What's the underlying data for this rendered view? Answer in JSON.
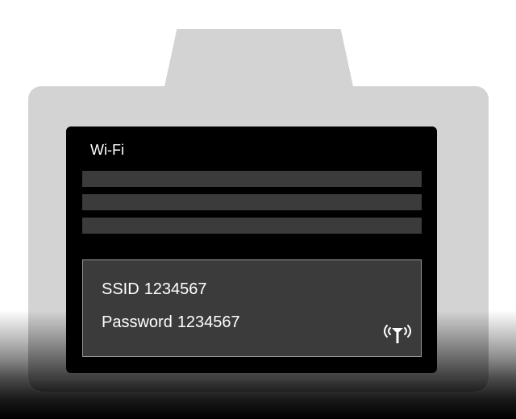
{
  "screen": {
    "title": "Wi-Fi"
  },
  "connection_info": {
    "ssid_label": "SSID",
    "ssid_value": "1234567",
    "password_label": "Password",
    "password_value": "1234567"
  },
  "icons": {
    "status": "wifi-antenna-icon"
  },
  "colors": {
    "camera_body": "#d3d3d3",
    "screen_bg": "#000000",
    "bar_fill": "#3b3b3b",
    "panel_border": "#9a9a9a",
    "text": "#ffffff"
  }
}
